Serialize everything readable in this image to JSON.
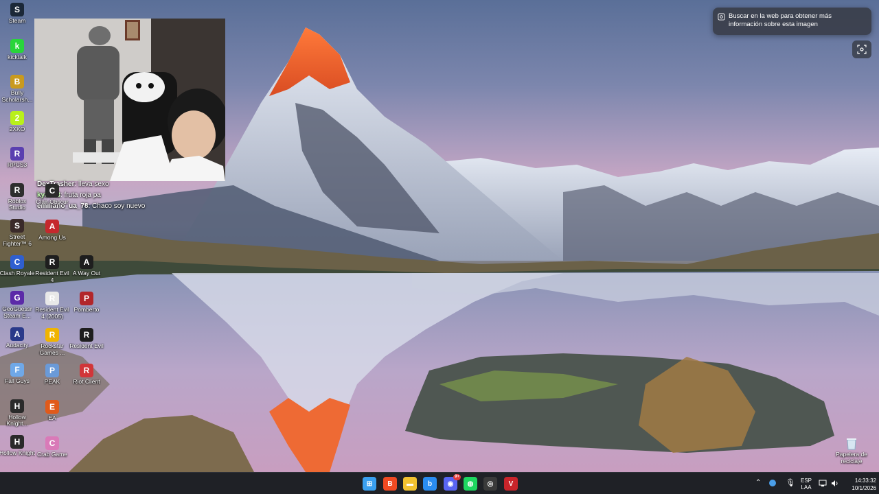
{
  "desktop_icons_col1": [
    {
      "label": "Steam",
      "icon": "steam-icon",
      "color": "#1b2838"
    },
    {
      "label": "kicktalk",
      "icon": "kicktalk-icon",
      "color": "#29d53a"
    },
    {
      "label": "Bully Scholarsh...",
      "icon": "bully-icon",
      "color": "#c99a1f"
    },
    {
      "label": "2XKO",
      "icon": "2xko-icon",
      "color": "#b9f01b"
    },
    {
      "label": "RPCS3",
      "icon": "rpcs3-icon",
      "color": "#5a3fb0"
    },
    {
      "label": "Roblox Studio",
      "icon": "roblox-studio-icon",
      "color": "#2d2d2d"
    },
    {
      "label": "Street Fighter™ 6",
      "icon": "street-fighter-icon",
      "color": "#3a2a2a"
    },
    {
      "label": "Clash Royale",
      "icon": "clash-royale-icon",
      "color": "#2f5fd0"
    },
    {
      "label": "GeoGuessr Steam E...",
      "icon": "geoguessr-icon",
      "color": "#5b2aa8"
    },
    {
      "label": "Audacity",
      "icon": "audacity-icon",
      "color": "#2a3a8a"
    },
    {
      "label": "Fall Guys",
      "icon": "fall-guys-icon",
      "color": "#6fa8e8"
    },
    {
      "label": "Hollow Knight...",
      "icon": "hollow-knight-icon",
      "color": "#2a2a2a"
    },
    {
      "label": "Hollow Knight",
      "icon": "hollow-knight-2-icon",
      "color": "#2a2a2a"
    }
  ],
  "desktop_icons_col2": [
    {
      "label": "Clair Obscur",
      "icon": "clair-obscur-icon",
      "color": "#2a2a2a"
    },
    {
      "label": "Among Us",
      "icon": "among-us-icon",
      "color": "#c5282d"
    },
    {
      "label": "Resident Evil 4",
      "icon": "resident-evil-4-icon",
      "color": "#1e1e1e"
    },
    {
      "label": "Resident Evil 4 (2005)",
      "icon": "resident-evil-4-2005-icon",
      "color": "#e8e8e8"
    },
    {
      "label": "Rockstar Games ...",
      "icon": "rockstar-icon",
      "color": "#f0b400"
    },
    {
      "label": "PEAK",
      "icon": "peak-icon",
      "color": "#6a9ad8"
    },
    {
      "label": "EA",
      "icon": "ea-icon",
      "color": "#e05a1a"
    },
    {
      "label": "Crab Game",
      "icon": "crab-game-icon",
      "color": "#d97ab8"
    }
  ],
  "desktop_icons_col3": [
    {
      "label": "A Way Out",
      "icon": "a-way-out-icon",
      "color": "#1e1e1e"
    },
    {
      "label": "Pomberto",
      "icon": "pomberto-icon",
      "color": "#b2262a"
    },
    {
      "label": "Resident Evil",
      "icon": "resident-evil-icon",
      "color": "#1e1e1e"
    },
    {
      "label": "Riot Client",
      "icon": "riot-client-icon",
      "color": "#d13639"
    }
  ],
  "recycle_bin": {
    "label": "Papelera de reciclaje"
  },
  "chat": [
    {
      "user": "DexTrasher",
      "message": "lleva sexo",
      "green": false
    },
    {
      "user": "ky80n3",
      "message": "fruta roja pa",
      "green": true
    },
    {
      "user": "emiliano_ua_78",
      "message": "Chaco soy nuevo",
      "green": false
    }
  ],
  "lens": {
    "tooltip": "Buscar en la web para obtener más información sobre esta imagen"
  },
  "taskbar": {
    "apps": [
      {
        "name": "start-button",
        "icon": "windows-icon",
        "color": "#3aa0f0"
      },
      {
        "name": "brave-button",
        "icon": "brave-icon",
        "color": "#f04a22"
      },
      {
        "name": "file-explorer-button",
        "icon": "folder-icon",
        "color": "#f2c230"
      },
      {
        "name": "bing-button",
        "icon": "bing-icon",
        "color": "#2a8cf0"
      },
      {
        "name": "discord-button",
        "icon": "discord-icon",
        "color": "#5865f2",
        "badge": "9+"
      },
      {
        "name": "spotify-button",
        "icon": "spotify-icon",
        "color": "#1ed760"
      },
      {
        "name": "obs-button",
        "icon": "obs-icon",
        "color": "#3a3a3a"
      },
      {
        "name": "voicemeeter-button",
        "icon": "voicemeeter-icon",
        "color": "#c8242a"
      }
    ],
    "language": "ESP",
    "layout": "LAA",
    "time": "14:33:32",
    "date": "10/1/2026"
  }
}
